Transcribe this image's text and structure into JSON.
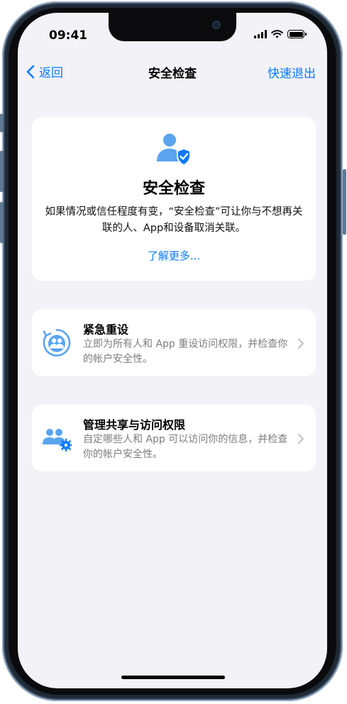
{
  "status_bar": {
    "time": "09:41"
  },
  "nav": {
    "back_label": "返回",
    "title": "安全检查",
    "exit_label": "快速退出"
  },
  "hero": {
    "icon": "person-shield-icon",
    "title": "安全检查",
    "description": "如果情况或信任程度有变，“安全检查”可让你与不想再关联的人、App和设备取消关联。",
    "link_label": "了解更多..."
  },
  "options": [
    {
      "icon": "emergency-reset-icon",
      "title": "紧急重设",
      "description": "立即为所有人和 App 重设访问权限，并检查你的帐户安全性。"
    },
    {
      "icon": "people-gear-icon",
      "title": "管理共享与访问权限",
      "description": "自定哪些人和 App 可以访问你的信息，并检查你的帐户安全性。"
    }
  ],
  "colors": {
    "accent": "#0a7aff",
    "icon_blue": "#5aa4f0",
    "background": "#f2f2f7",
    "secondary_text": "#7c7c82"
  }
}
